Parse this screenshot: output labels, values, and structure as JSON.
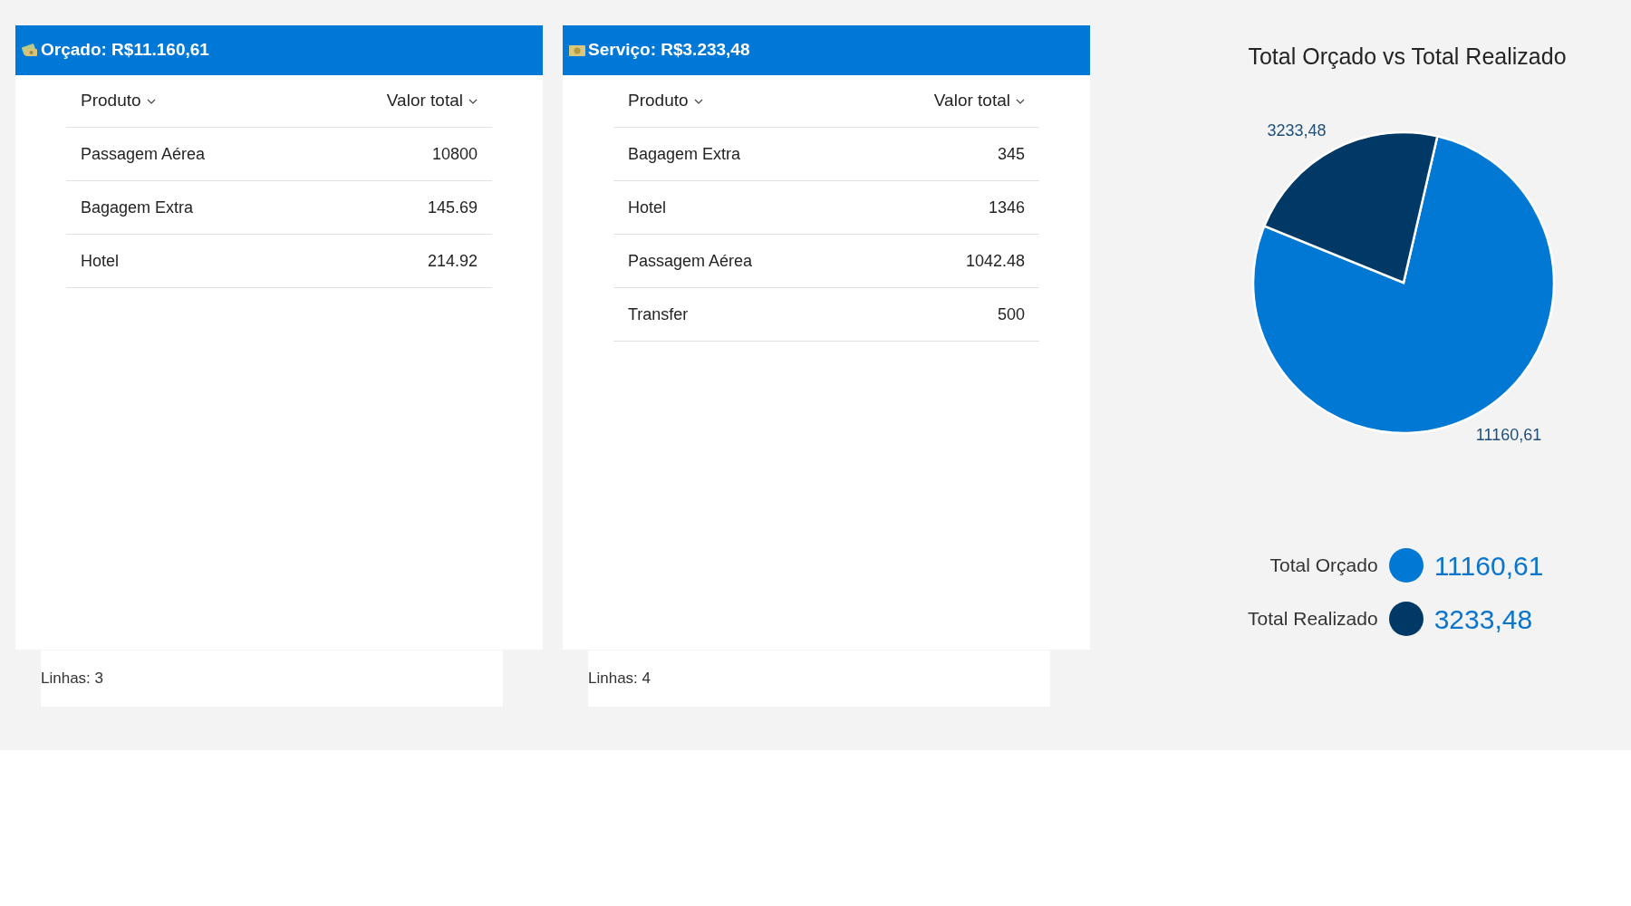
{
  "tables": [
    {
      "title": "Orçado: R$11.160,61",
      "columns": [
        "Produto",
        "Valor total"
      ],
      "rows": [
        [
          "Passagem Aérea",
          "10800"
        ],
        [
          "Bagagem Extra",
          "145.69"
        ],
        [
          "Hotel",
          "214.92"
        ]
      ],
      "footer": "Linhas: 3"
    },
    {
      "title": "Serviço: R$3.233,48",
      "columns": [
        "Produto",
        "Valor total"
      ],
      "rows": [
        [
          "Bagagem Extra",
          "345"
        ],
        [
          "Hotel",
          "1346"
        ],
        [
          "Passagem Aérea",
          "1042.48"
        ],
        [
          "Transfer",
          "500"
        ]
      ],
      "footer": "Linhas: 4"
    }
  ],
  "chart": {
    "chart_data": {
      "type": "pie",
      "title": "Total Orçado vs Total Realizado",
      "categories": [
        "Total Orçado",
        "Total Realizado"
      ],
      "values": [
        11160.61,
        3233.48
      ],
      "data_labels": true,
      "value_labels": [
        "11160,61",
        "3233,48"
      ]
    }
  },
  "legend": [
    {
      "color": "#0078d4",
      "value": "11160,61"
    },
    {
      "color": "#003966",
      "value": "3233,48"
    }
  ]
}
